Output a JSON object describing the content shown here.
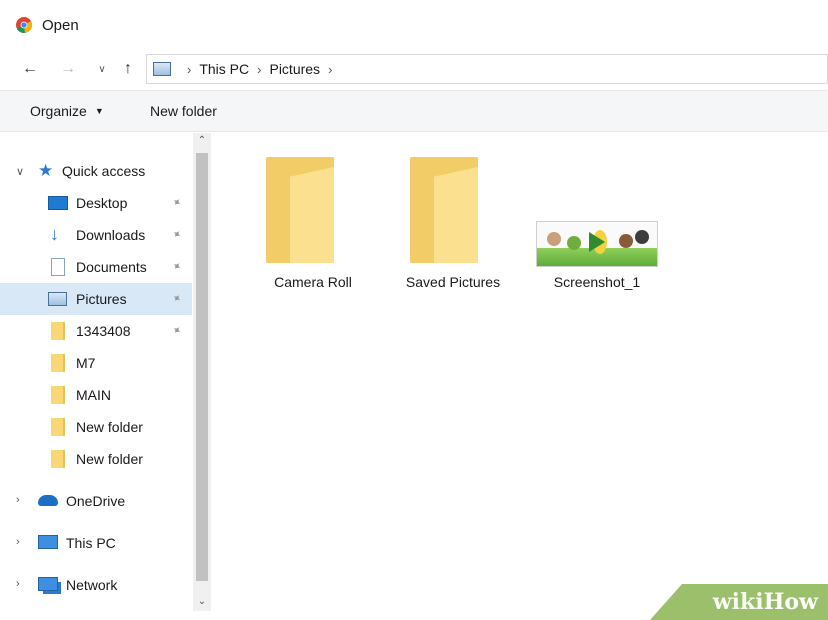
{
  "window": {
    "title": "Open",
    "app_icon": "chrome-icon"
  },
  "navigation": {
    "back_icon": "arrow-left-icon",
    "forward_icon": "arrow-right-icon",
    "recent_icon": "chevron-down-icon",
    "up_icon": "arrow-up-icon",
    "breadcrumb": [
      "This PC",
      "Pictures"
    ]
  },
  "toolbar": {
    "organize_label": "Organize",
    "new_folder_label": "New folder"
  },
  "sidebar": {
    "quick_access_label": "Quick access",
    "quick_items": [
      {
        "label": "Desktop",
        "icon": "desktop-icon",
        "pinned": true
      },
      {
        "label": "Downloads",
        "icon": "download-icon",
        "pinned": true
      },
      {
        "label": "Documents",
        "icon": "documents-icon",
        "pinned": true
      },
      {
        "label": "Pictures",
        "icon": "pictures-icon",
        "pinned": true,
        "selected": true
      },
      {
        "label": "1343408",
        "icon": "folder-icon",
        "pinned": true
      },
      {
        "label": "M7",
        "icon": "folder-icon",
        "pinned": false
      },
      {
        "label": "MAIN",
        "icon": "folder-icon",
        "pinned": false
      },
      {
        "label": "New folder",
        "icon": "folder-icon",
        "pinned": false
      },
      {
        "label": "New folder",
        "icon": "folder-icon",
        "pinned": false
      }
    ],
    "roots": [
      {
        "label": "OneDrive",
        "icon": "onedrive-icon"
      },
      {
        "label": "This PC",
        "icon": "this-pc-icon"
      },
      {
        "label": "Network",
        "icon": "network-icon"
      }
    ]
  },
  "files": [
    {
      "name": "Camera Roll",
      "type": "folder"
    },
    {
      "name": "Saved Pictures",
      "type": "folder"
    },
    {
      "name": "Screenshot_1",
      "type": "image"
    }
  ],
  "watermark": {
    "part1": "wiki",
    "part2": "How"
  },
  "colors": {
    "selection": "#d9e8f7",
    "folder": "#f8d775",
    "toolbar_bg": "#f5f6f7"
  }
}
